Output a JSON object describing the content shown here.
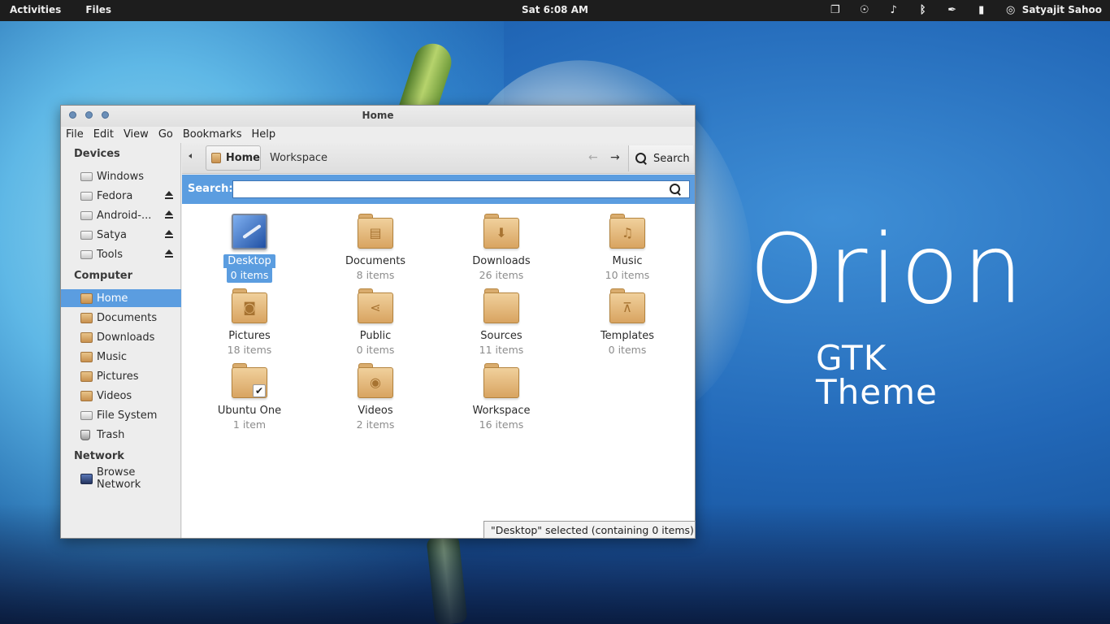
{
  "topbar": {
    "activities": "Activities",
    "app_menu": "Files",
    "clock": "Sat  6:08 AM",
    "user": "Satyajit Sahoo",
    "tray_icons": [
      "clipboard-icon",
      "accessibility-icon",
      "volume-icon",
      "bluetooth-icon",
      "pen-icon",
      "battery-icon",
      "chat-status-icon"
    ]
  },
  "wallpaper": {
    "title": "Orion",
    "subtitle": "GTK Theme"
  },
  "window": {
    "title": "Home",
    "menu": [
      "File",
      "Edit",
      "View",
      "Go",
      "Bookmarks",
      "Help"
    ],
    "sidebar": {
      "devices_header": "Devices",
      "devices": [
        {
          "label": "Windows",
          "icon": "drive-icon",
          "eject": false
        },
        {
          "label": "Fedora",
          "icon": "drive-icon",
          "eject": true
        },
        {
          "label": "Android-...",
          "icon": "drive-icon",
          "eject": true
        },
        {
          "label": "Satya",
          "icon": "drive-icon",
          "eject": true
        },
        {
          "label": "Tools",
          "icon": "drive-icon",
          "eject": true
        }
      ],
      "computer_header": "Computer",
      "computer": [
        {
          "label": "Home",
          "icon": "home-folder-icon",
          "active": true
        },
        {
          "label": "Documents",
          "icon": "documents-folder-icon"
        },
        {
          "label": "Downloads",
          "icon": "downloads-folder-icon"
        },
        {
          "label": "Music",
          "icon": "music-folder-icon"
        },
        {
          "label": "Pictures",
          "icon": "pictures-folder-icon"
        },
        {
          "label": "Videos",
          "icon": "videos-folder-icon"
        },
        {
          "label": "File System",
          "icon": "drive-icon"
        },
        {
          "label": "Trash",
          "icon": "trash-icon"
        }
      ],
      "network_header": "Network",
      "network": [
        {
          "label": "Browse Network",
          "icon": "network-icon"
        }
      ]
    },
    "toolbar": {
      "crumbs": [
        "Home",
        "Workspace"
      ],
      "search_label": "Search"
    },
    "searchbar": {
      "label": "Search:",
      "value": ""
    },
    "files": [
      {
        "name": "Desktop",
        "count": "0 items",
        "selected": true,
        "emblem": ""
      },
      {
        "name": "Documents",
        "count": "8 items",
        "emblem": "▤"
      },
      {
        "name": "Downloads",
        "count": "26 items",
        "emblem": "⬇"
      },
      {
        "name": "Music",
        "count": "10 items",
        "emblem": "♫"
      },
      {
        "name": "Pictures",
        "count": "18 items",
        "emblem": "◙"
      },
      {
        "name": "Public",
        "count": "0 items",
        "emblem": "⋖"
      },
      {
        "name": "Sources",
        "count": "11 items",
        "emblem": ""
      },
      {
        "name": "Templates",
        "count": "0 items",
        "emblem": "⊼"
      },
      {
        "name": "Ubuntu One",
        "count": "1 item",
        "emblem": "✔"
      },
      {
        "name": "Videos",
        "count": "2 items",
        "emblem": "◉"
      },
      {
        "name": "Workspace",
        "count": "16 items",
        "emblem": ""
      }
    ],
    "status": "\"Desktop\" selected (containing 0 items)"
  }
}
